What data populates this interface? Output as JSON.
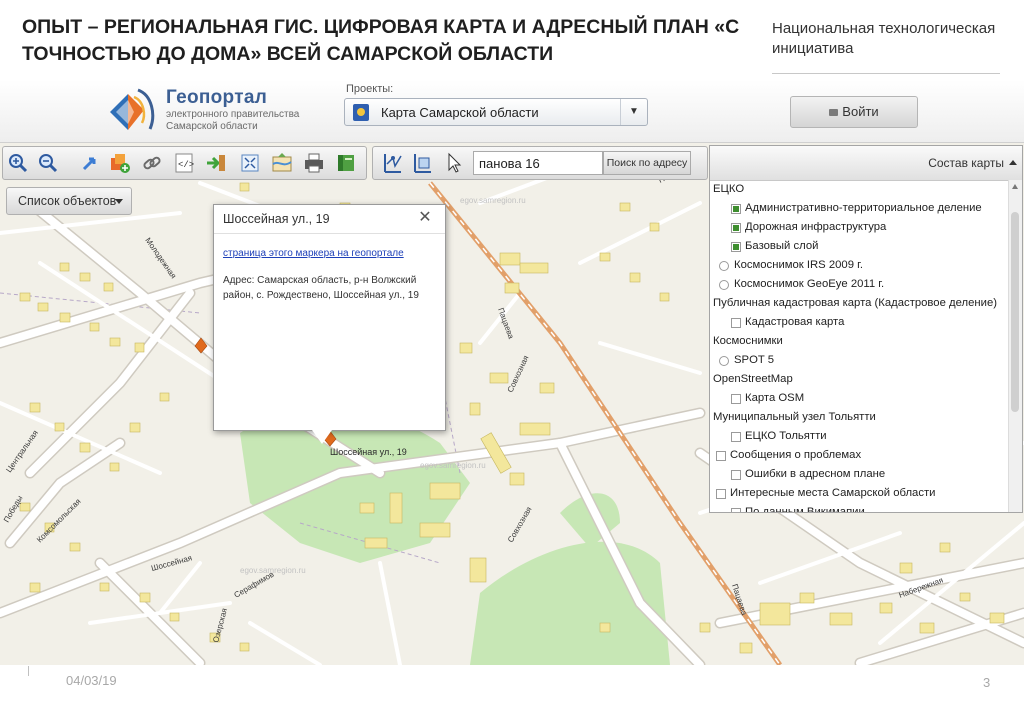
{
  "slide": {
    "title": "ОПЫТ – РЕГИОНАЛЬНАЯ ГИС. ЦИФРОВАЯ КАРТА И АДРЕСНЫЙ ПЛАН «С ТОЧНОСТЬЮ ДО ДОМА» ВСЕЙ САМАРСКОЙ ОБЛАСТИ",
    "org": "Национальная технологическая инициатива",
    "date": "04/03/19",
    "page": "3"
  },
  "header": {
    "logo_title": "Геопортал",
    "logo_sub": "электронного правительства Самарской области",
    "projects_label": "Проекты:",
    "project_selected": "Карта Самарской области",
    "login_label": "Войти"
  },
  "toolbar": {
    "search_value": "панова 16",
    "search_button": "Поиск по адресу",
    "object_list": "Список объектов",
    "icons": [
      "zoom-in-icon",
      "zoom-out-icon",
      "pan-icon",
      "add-layer-icon",
      "link-icon",
      "code-icon",
      "export-icon",
      "extent-icon",
      "print-icon",
      "book-icon"
    ]
  },
  "popup": {
    "title": "Шоссейная ул., 19",
    "link": "страница этого маркера на геопортале",
    "address": "Адрес: Самарская область, р-н Волжский район, с. Рождествено, Шоссейная ул., 19"
  },
  "layers": {
    "title": "Состав карты",
    "items": [
      {
        "label": "ЕЦКО",
        "kind": "group"
      },
      {
        "label": "Административно-территориальное деление",
        "kind": "check",
        "on": true
      },
      {
        "label": "Дорожная инфраструктура",
        "kind": "check",
        "on": true
      },
      {
        "label": "Базовый слой",
        "kind": "check",
        "on": true
      },
      {
        "label": "Космоснимок IRS 2009 г.",
        "kind": "radio"
      },
      {
        "label": "Космоснимок GeoEye 2011 г.",
        "kind": "radio"
      },
      {
        "label": "Публичная кадастровая карта (Кадастровое деление)",
        "kind": "group"
      },
      {
        "label": "Кадастровая карта",
        "kind": "check",
        "on": false
      },
      {
        "label": "Космоснимки",
        "kind": "group"
      },
      {
        "label": "SPOT 5",
        "kind": "radio"
      },
      {
        "label": "OpenStreetMap",
        "kind": "group"
      },
      {
        "label": "Карта OSM",
        "kind": "check",
        "on": false
      },
      {
        "label": "Муниципальный узел Тольятти",
        "kind": "group"
      },
      {
        "label": "ЕЦКО Тольятти",
        "kind": "check",
        "on": false
      },
      {
        "label": "Сообщения о проблемах",
        "kind": "groupcheck",
        "on": false
      },
      {
        "label": "Ошибки в адресном плане",
        "kind": "check",
        "on": false
      },
      {
        "label": "Интересные места Самарской области",
        "kind": "groupcheck",
        "on": false
      },
      {
        "label": "По данным Викимапии",
        "kind": "check",
        "on": false
      }
    ]
  },
  "map": {
    "watermark": "egov.samregion.ru",
    "streets": [
      "Шоссейная ул., 19",
      "Пацаева",
      "Пацаева",
      "Совхозная",
      "Совхозная",
      "Комсомольская",
      "Шоссейная",
      "Шоссейная",
      "Серафимов",
      "Озерская",
      "Набережная",
      "Полевая",
      "Молодежная",
      "Центральная",
      "Победы",
      "Цент"
    ]
  },
  "colors": {
    "map_bg": "#f2f0e8",
    "building": "#f3e79c",
    "green": "#c7e7b5",
    "road": "#ffffff",
    "rail": "#e2a06a",
    "marker": "#e06a1e",
    "title": "#1f1f1f"
  }
}
